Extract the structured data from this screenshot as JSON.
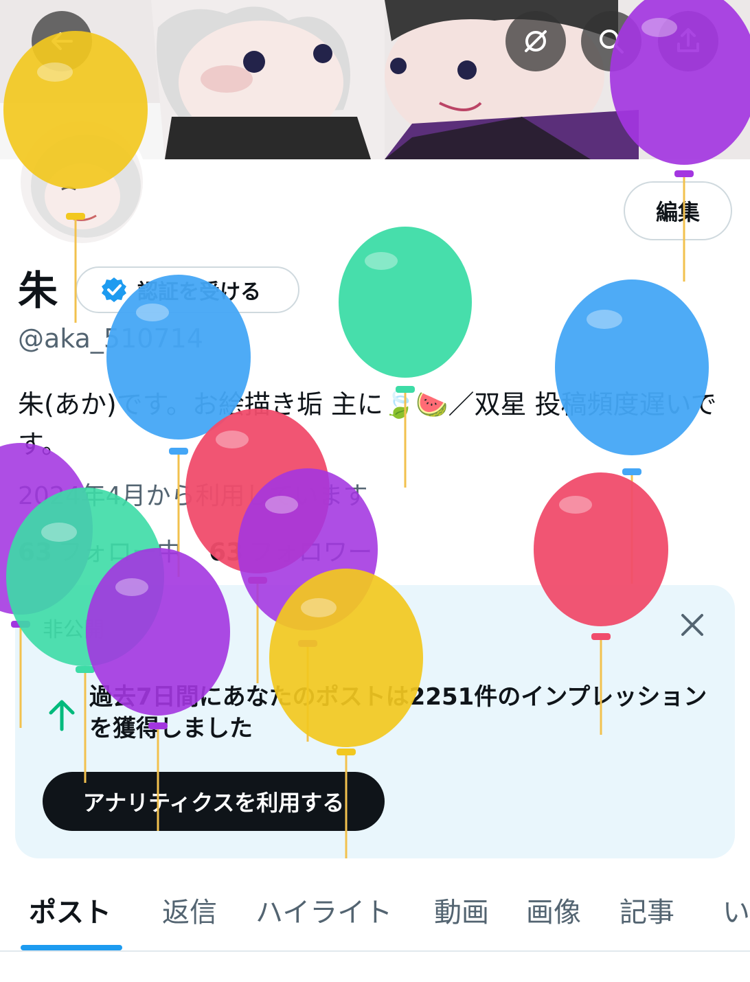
{
  "profile": {
    "display_name": "朱",
    "verify_label": "認証を受ける",
    "handle": "@aka_510714",
    "bio": "朱(あか)です。お絵描き垢 主に🍃🍉／双星 投稿頻度遅いです。",
    "joined": "2024年4月から利用しています",
    "following_count": "63",
    "following_label": "フォロー中",
    "followers_count": "63",
    "followers_label": "フォロワー",
    "edit_label": "編集"
  },
  "card": {
    "label": "非公開",
    "text": "過去7日間にあなたのポストは2251件のインプレッションを獲得しました",
    "button_label": "アナリティクスを利用する"
  },
  "tabs": [
    {
      "label": "ポスト"
    },
    {
      "label": "返信"
    },
    {
      "label": "ハイライト"
    },
    {
      "label": "動画"
    },
    {
      "label": "画像"
    },
    {
      "label": "記事"
    },
    {
      "label": "い"
    }
  ],
  "icons": {
    "back": "back-arrow-icon",
    "hide": "eye-slash-icon",
    "search": "search-icon",
    "share": "share-icon"
  },
  "colors": {
    "accent": "#1d9bf0",
    "card_bg": "#e9f6fc"
  }
}
